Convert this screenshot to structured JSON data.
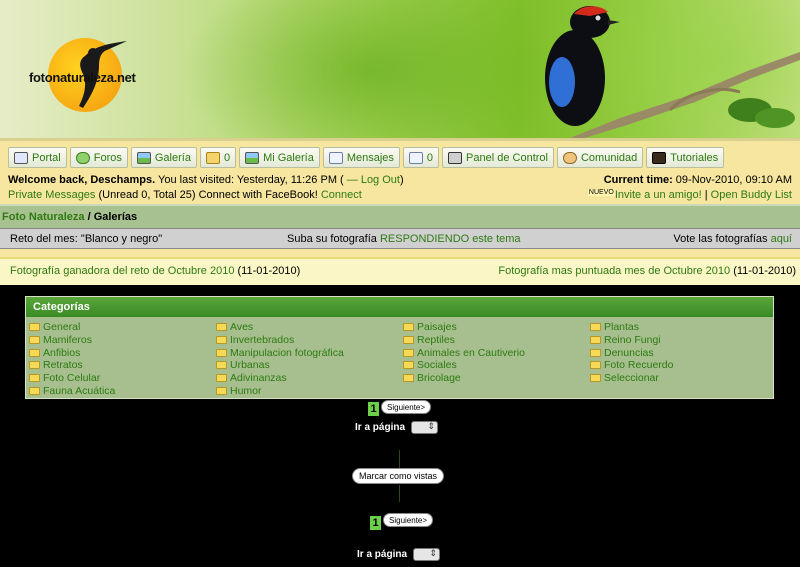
{
  "logo": {
    "text": "fotonaturaleza.net"
  },
  "nav": {
    "items": [
      {
        "label": "Portal",
        "icon": "portal-icon"
      },
      {
        "label": "Foros",
        "icon": "forum-icon"
      },
      {
        "label": "Galería",
        "icon": "gallery-icon"
      },
      {
        "label": "0",
        "icon": "folder-upload-icon"
      },
      {
        "label": "Mi Galería",
        "icon": "my-gallery-icon"
      },
      {
        "label": "Mensajes",
        "icon": "mail-icon"
      },
      {
        "label": "0",
        "icon": "mail-new-icon"
      },
      {
        "label": "Panel de Control",
        "icon": "tools-icon"
      },
      {
        "label": "Comunidad",
        "icon": "users-icon"
      },
      {
        "label": "Tutoriales",
        "icon": "film-icon"
      }
    ]
  },
  "welcome": {
    "greeting": "Welcome back, Deschamps.",
    "last_visit": " You last visited: Yesterday, 11:26 PM ( ",
    "logout": "— Log Out",
    "close": ")",
    "private_messages": "Private Messages",
    "pm_counts": " (Unread 0, Total 25) Connect with FaceBook! ",
    "connect": "Connect"
  },
  "time": {
    "label": "Current time:",
    "value": " 09-Nov-2010, 09:10 AM"
  },
  "invite": {
    "badge": "NUEVO",
    "invite_label": "Invite a un amigo!",
    "sep": " | ",
    "buddy": "Open Buddy List"
  },
  "breadcrumb": {
    "root": "Foto Naturaleza",
    "sep": " / ",
    "current": "Galerías"
  },
  "challenge": {
    "left": "Reto del mes: \"Blanco y negro\"",
    "center_prefix": "Suba su fotografía ",
    "center_link": "RESPONDIENDO este tema",
    "right_prefix": "Vote las fotografías ",
    "right_link": "aquí"
  },
  "winners": {
    "left_link": "Fotografía ganadora del reto de Octubre 2010",
    "left_date": " (11-01-2010)",
    "right_link": "Fotografía mas puntuada mes de Octubre 2010",
    "right_date": " (11-01-2010)"
  },
  "categories": {
    "title": "Categorías",
    "col1": [
      "General",
      "Mamiferos",
      "Anfibios",
      "Retratos",
      "Foto Celular",
      "Fauna Acuática"
    ],
    "col2": [
      "Aves",
      "Invertebrados",
      "Manipulacion fotográfica",
      "Urbanas",
      "Adivinanzas",
      "Humor"
    ],
    "col3": [
      "Paisajes",
      "Reptiles",
      "Animales en Cautiverio",
      "Sociales",
      "Bricolage"
    ],
    "col4": [
      "Plantas",
      "Reino Fungi",
      "Denuncias",
      "Foto Recuerdo",
      "Seleccionar"
    ]
  },
  "pager": {
    "page": "1",
    "next": "Siguiente>",
    "goto": "Ir a página",
    "mark_viewed": "Marcar como vistas"
  },
  "colors": {
    "link": "#2d7a12",
    "nav_bg": "#f6e6a0",
    "cat_header": "#3a8a24",
    "cat_bg": "#a7bf8e"
  }
}
